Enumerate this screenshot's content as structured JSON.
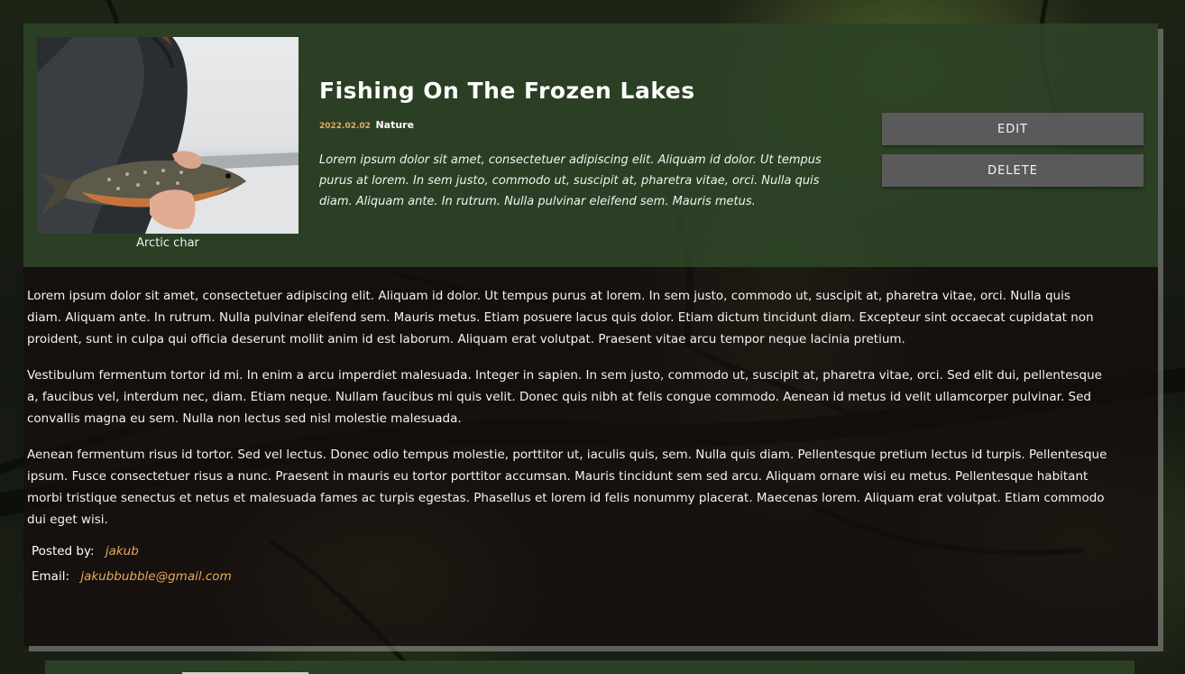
{
  "post": {
    "title": "Fishing On The Frozen Lakes",
    "date": "2022.02.02",
    "category": "Nature",
    "excerpt": "Lorem ipsum dolor sit amet, consectetuer adipiscing elit. Aliquam id dolor. Ut tempus purus at lorem. In sem justo, commodo ut, suscipit at, pharetra vitae, orci. Nulla quis diam. Aliquam ante. In rutrum. Nulla pulvinar eleifend sem. Mauris metus.",
    "image_caption": "Arctic char",
    "paragraphs": [
      "Lorem ipsum dolor sit amet, consectetuer adipiscing elit. Aliquam id dolor. Ut tempus purus at lorem. In sem justo, commodo ut, suscipit at, pharetra vitae, orci. Nulla quis diam. Aliquam ante. In rutrum. Nulla pulvinar eleifend sem. Mauris metus. Etiam posuere lacus quis dolor. Etiam dictum tincidunt diam. Excepteur sint occaecat cupidatat non proident, sunt in culpa qui officia deserunt mollit anim id est laborum. Aliquam erat volutpat. Praesent vitae arcu tempor neque lacinia pretium.",
      "Vestibulum fermentum tortor id mi. In enim a arcu imperdiet malesuada. Integer in sapien. In sem justo, commodo ut, suscipit at, pharetra vitae, orci. Sed elit dui, pellentesque a, faucibus vel, interdum nec, diam. Etiam neque. Nullam faucibus mi quis velit. Donec quis nibh at felis congue commodo. Aenean id metus id velit ullamcorper pulvinar. Sed convallis magna eu sem. Nulla non lectus sed nisl molestie malesuada.",
      "Aenean fermentum risus id tortor. Sed vel lectus. Donec odio tempus molestie, porttitor ut, iaculis quis, sem. Nulla quis diam. Pellentesque pretium lectus id turpis. Pellentesque ipsum. Fusce consectetuer risus a nunc. Praesent in mauris eu tortor porttitor accumsan. Mauris tincidunt sem sed arcu. Aliquam ornare wisi eu metus. Pellentesque habitant morbi tristique senectus et netus et malesuada fames ac turpis egestas. Phasellus et lorem id felis nonummy placerat. Maecenas lorem. Aliquam erat volutpat. Etiam commodo dui eget wisi."
    ],
    "author_label": "Posted by:",
    "author": "jakub",
    "email_label": "Email:",
    "email": "jakubbubble@gmail.com"
  },
  "actions": {
    "edit_label": "EDIT",
    "delete_label": "DELETE"
  },
  "colors": {
    "header_bg": "#2c4226",
    "accent": "#e8a95a",
    "button_bg": "#5a5a5a"
  }
}
